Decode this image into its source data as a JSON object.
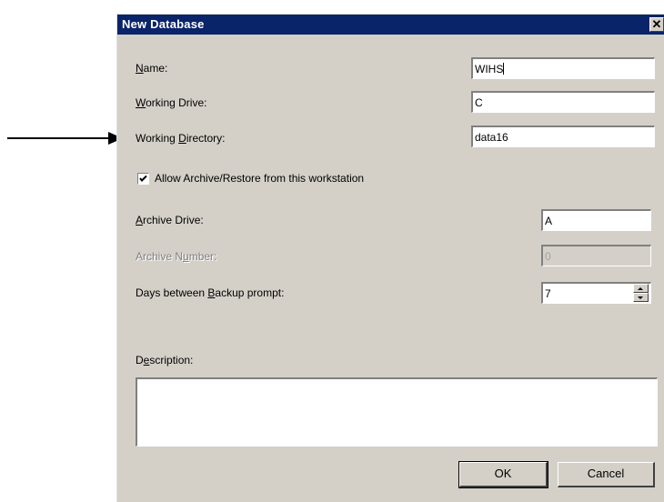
{
  "dialog": {
    "title": "New Database",
    "close_glyph": "✕"
  },
  "fields": {
    "name_label": "Name:",
    "name_value": "WIHS",
    "working_drive_label": "Working Drive:",
    "working_drive_value": "C",
    "working_directory_label": "Working Directory:",
    "working_directory_value": "data16",
    "allow_archive_label": "Allow Archive/Restore from this workstation",
    "allow_archive_checked": true,
    "archive_drive_label": "Archive Drive:",
    "archive_drive_value": "A",
    "archive_number_label": "Archive Number:",
    "archive_number_value": "0",
    "days_backup_label": "Days between Backup prompt:",
    "days_backup_value": "7",
    "description_label": "Description:",
    "description_value": ""
  },
  "buttons": {
    "ok_label": "OK",
    "cancel_label": "Cancel"
  },
  "icons": {
    "checkbox_check": "check-icon",
    "annotation_arrow": "arrow-right-icon"
  },
  "colors": {
    "titlebar": "#0a246a",
    "dialog_face": "#d4d0c8"
  }
}
